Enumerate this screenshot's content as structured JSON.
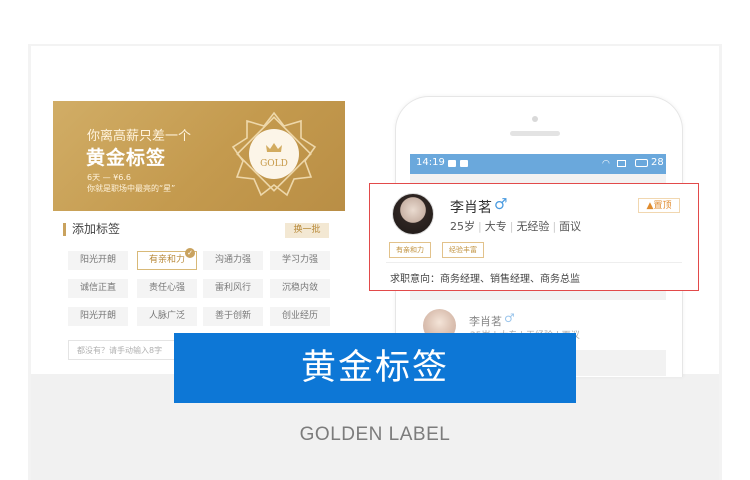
{
  "gold_panel": {
    "subtitle": "你离高薪只差一个",
    "title": "黄金标签",
    "price": "6天 — ¥6.6",
    "slogan": "你就是职场中最亮的“星”",
    "badge_text": "GOLD",
    "gradient_color": "#c49a4e"
  },
  "tags": {
    "header": "添加标签",
    "refresh_label": "换一批",
    "items": [
      "阳光开朗",
      "有亲和力",
      "沟通力强",
      "学习力强",
      "诚信正直",
      "责任心强",
      "雷利风行",
      "沉稳内敛",
      "阳光开朗",
      "人脉广泛",
      "善于创新",
      "创业经历"
    ],
    "selected": "有亲和力",
    "custom_placeholder": "都没有？请手动输入8字"
  },
  "phone": {
    "status_time": "14:19",
    "battery": "28",
    "statusbar_color": "#6aa8dc"
  },
  "profile": {
    "name": "李肖茗",
    "gender_icon": "male-icon",
    "age": "25岁",
    "education": "大专",
    "experience": "无经验",
    "salary": "面议",
    "top_button": "置顶",
    "tags": [
      "有亲和力",
      "经验丰富"
    ],
    "intent": "求职意向：商务经理、销售经理、商务总监",
    "highlight_color": "#e24a4a"
  },
  "profile2": {
    "name": "李肖茗",
    "meta": "25岁 | 大专 | 无经验 | 面议"
  },
  "banner": {
    "title": "黄金标签",
    "color": "#0d77d6"
  },
  "caption": "GOLDEN LABEL"
}
